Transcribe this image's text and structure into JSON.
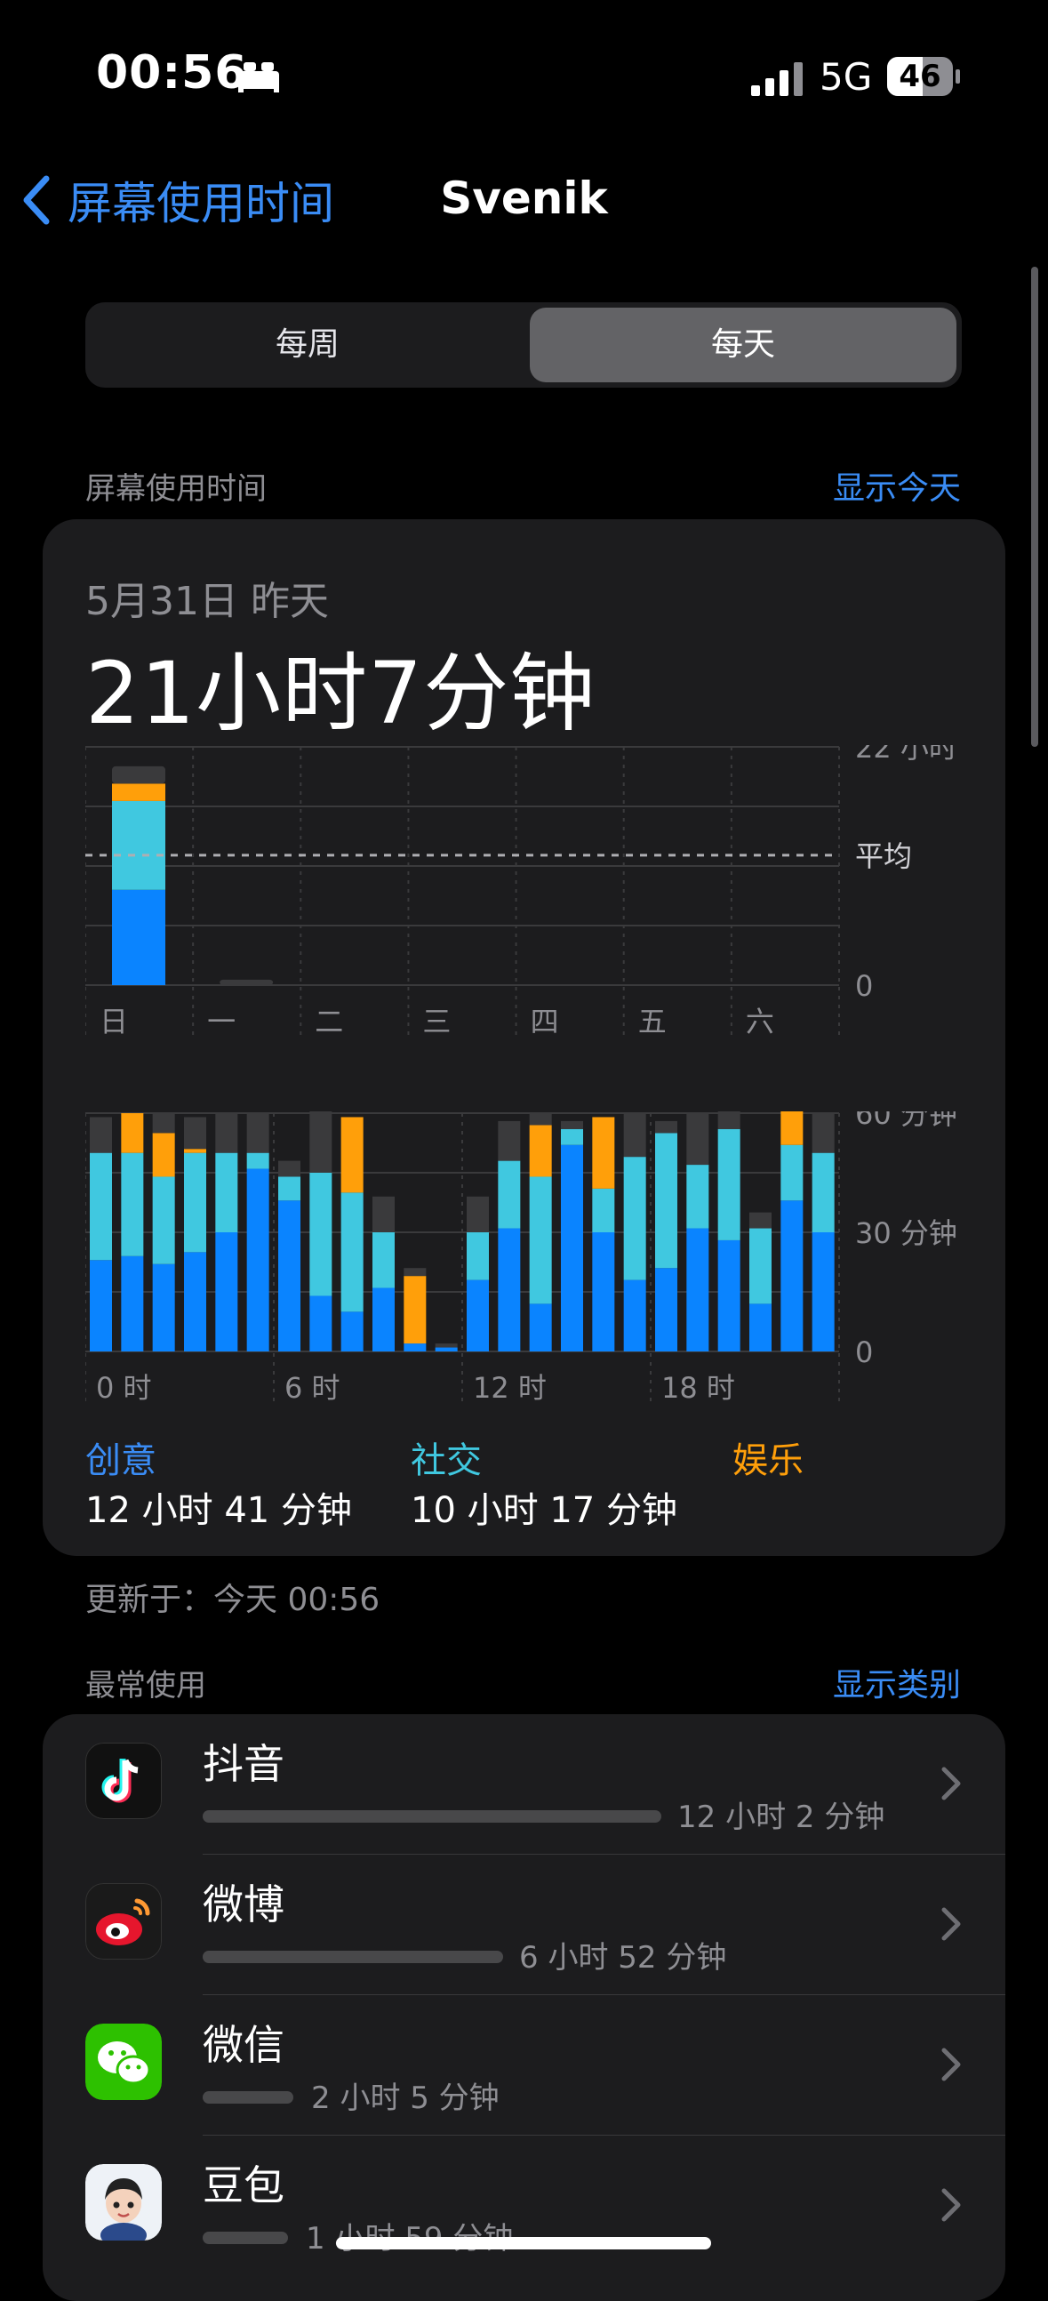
{
  "status_bar": {
    "time": "00:56",
    "network": "5G",
    "battery": "46"
  },
  "nav": {
    "back_label": "屏幕使用时间",
    "title": "Svenik"
  },
  "segmented": {
    "week": "每周",
    "day": "每天"
  },
  "screen_time_section": {
    "label": "屏幕使用时间",
    "link": "显示今天"
  },
  "summary": {
    "date": "5月31日 昨天",
    "total": "21小时7分钟"
  },
  "colors": {
    "creative": "#0a84ff",
    "social": "#40c8e0",
    "entertainment": "#ff9f0a",
    "other": "#3a3a3c",
    "accent": "#3a8cf5"
  },
  "chart_data": [
    {
      "type": "bar",
      "stacked": true,
      "categories": [
        "日",
        "一",
        "二",
        "三",
        "四",
        "五",
        "六"
      ],
      "series": [
        {
          "name": "创意",
          "values": [
            8.8,
            0,
            0,
            0,
            0,
            0,
            0
          ]
        },
        {
          "name": "社交",
          "values": [
            8.2,
            0,
            0,
            0,
            0,
            0,
            0
          ]
        },
        {
          "name": "娱乐",
          "values": [
            1.6,
            0,
            0,
            0,
            0,
            0,
            0
          ]
        },
        {
          "values": [
            1.6,
            0.5,
            0,
            0,
            0,
            0,
            0
          ]
        }
      ],
      "ylim": [
        0,
        22
      ],
      "y_ticks": [
        "22 小时",
        "平均",
        "0"
      ],
      "average": 12
    },
    {
      "type": "bar",
      "stacked": true,
      "x_ticks": [
        "0 时",
        "6 时",
        "12 时",
        "18 时"
      ],
      "y_ticks": [
        "60 分钟",
        "30 分钟",
        "0"
      ],
      "ylim": [
        0,
        60
      ],
      "series": [
        {
          "name": "创意",
          "values": [
            23,
            24,
            22,
            25,
            30,
            46,
            38,
            14,
            10,
            16,
            2,
            1,
            18,
            31,
            12,
            52,
            30,
            18,
            21,
            31,
            28,
            12,
            38,
            30
          ]
        },
        {
          "name": "社交",
          "values": [
            27,
            26,
            22,
            25,
            20,
            4,
            6,
            31,
            30,
            14,
            0,
            0,
            12,
            17,
            32,
            4,
            11,
            31,
            34,
            16,
            28,
            19,
            14,
            20
          ]
        },
        {
          "name": "娱乐",
          "values": [
            0,
            10,
            11,
            1,
            0,
            0,
            0,
            0,
            19,
            0,
            17,
            0,
            0,
            0,
            13,
            0,
            18,
            0,
            0,
            0,
            0,
            0,
            12,
            0
          ]
        },
        {
          "values": [
            9,
            0,
            5,
            8,
            10,
            10,
            4,
            19,
            0,
            9,
            2,
            1,
            9,
            10,
            3,
            2,
            0,
            11,
            3,
            13,
            13,
            4,
            15,
            10
          ]
        }
      ]
    }
  ],
  "categories": [
    {
      "name": "创意",
      "time": "12 小时 41 分钟"
    },
    {
      "name": "社交",
      "time": "10 小时 17 分钟"
    },
    {
      "name": "娱乐"
    }
  ],
  "updated": "更新于：今天 00:56",
  "most_used_section": {
    "label": "最常使用",
    "link": "显示类别"
  },
  "apps": [
    {
      "name": "抖音",
      "time": "12 小时 2 分钟",
      "usage_fraction": 1.0
    },
    {
      "name": "微博",
      "time": "6 小时 52 分钟",
      "usage_fraction": 0.66
    },
    {
      "name": "微信",
      "time": "2 小时 5 分钟",
      "usage_fraction": 0.2
    },
    {
      "name": "豆包",
      "time": "1 小时 59 分钟",
      "usage_fraction": 0.19
    }
  ]
}
